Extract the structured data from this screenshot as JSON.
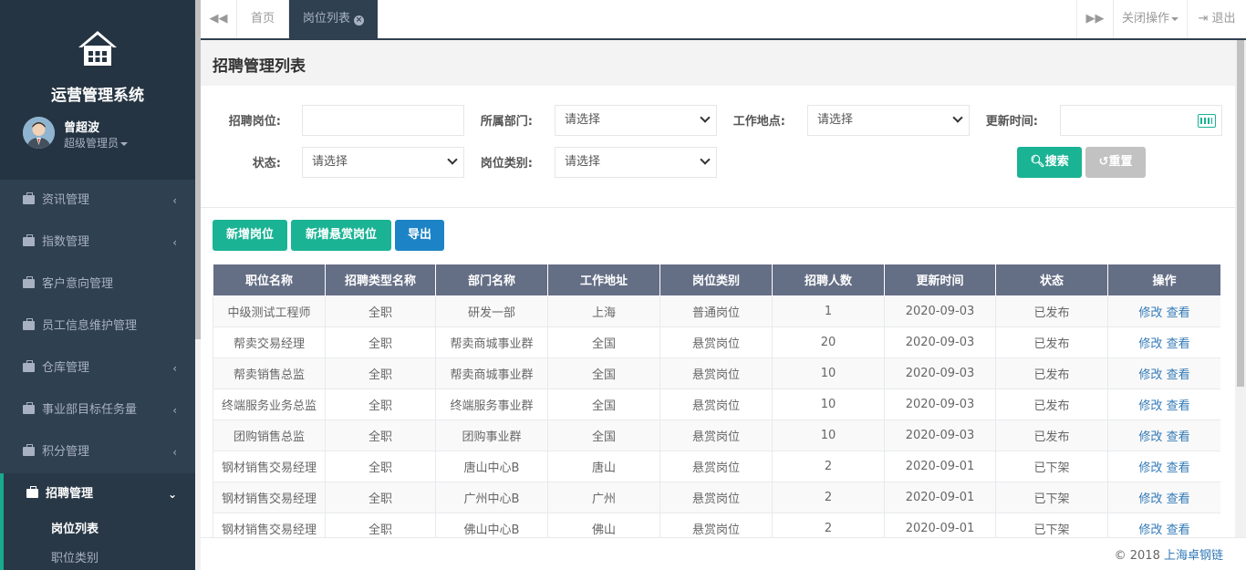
{
  "sidebar": {
    "title": "运营管理系统",
    "user_name": "曾超波",
    "user_role": "超级管理员",
    "menu": [
      {
        "label": "资讯管理",
        "has_arrow": true
      },
      {
        "label": "指数管理",
        "has_arrow": true
      },
      {
        "label": "客户意向管理",
        "has_arrow": false
      },
      {
        "label": "员工信息维护管理",
        "has_arrow": false
      },
      {
        "label": "仓库管理",
        "has_arrow": true
      },
      {
        "label": "事业部目标任务量",
        "has_arrow": true
      },
      {
        "label": "积分管理",
        "has_arrow": true
      }
    ],
    "active_menu": "招聘管理",
    "submenu": [
      "岗位列表",
      "职位类别"
    ]
  },
  "tabs": {
    "home": "首页",
    "active": "岗位列表",
    "close_ops": "关闭操作",
    "logout": "退出"
  },
  "page_title": "招聘管理列表",
  "form": {
    "post_label": "招聘岗位:",
    "post_value": "",
    "dept_label": "所属部门:",
    "dept_value": "请选择",
    "location_label": "工作地点:",
    "location_value": "请选择",
    "update_label": "更新时间:",
    "update_value": "",
    "status_label": "状态:",
    "status_value": "请选择",
    "category_label": "岗位类别:",
    "category_value": "请选择",
    "search_btn": "搜索",
    "reset_btn": "重置"
  },
  "actions": {
    "add_post": "新增岗位",
    "add_reward_post": "新增悬赏岗位",
    "export": "导出"
  },
  "table": {
    "headers": [
      "职位名称",
      "招聘类型名称",
      "部门名称",
      "工作地址",
      "岗位类别",
      "招聘人数",
      "更新时间",
      "状态",
      "操作"
    ],
    "rows": [
      [
        "中级测试工程师",
        "全职",
        "研发一部",
        "上海",
        "普通岗位",
        "1",
        "2020-09-03",
        "已发布"
      ],
      [
        "帮卖交易经理",
        "全职",
        "帮卖商城事业群",
        "全国",
        "悬赏岗位",
        "20",
        "2020-09-03",
        "已发布"
      ],
      [
        "帮卖销售总监",
        "全职",
        "帮卖商城事业群",
        "全国",
        "悬赏岗位",
        "10",
        "2020-09-03",
        "已发布"
      ],
      [
        "终端服务业务总监",
        "全职",
        "终端服务事业群",
        "全国",
        "悬赏岗位",
        "10",
        "2020-09-03",
        "已发布"
      ],
      [
        "团购销售总监",
        "全职",
        "团购事业群",
        "全国",
        "悬赏岗位",
        "10",
        "2020-09-03",
        "已发布"
      ],
      [
        "钢材销售交易经理",
        "全职",
        "唐山中心B",
        "唐山",
        "悬赏岗位",
        "2",
        "2020-09-01",
        "已下架"
      ],
      [
        "钢材销售交易经理",
        "全职",
        "广州中心B",
        "广州",
        "悬赏岗位",
        "2",
        "2020-09-01",
        "已下架"
      ],
      [
        "钢材销售交易经理",
        "全职",
        "佛山中心B",
        "佛山",
        "悬赏岗位",
        "2",
        "2020-09-01",
        "已下架"
      ]
    ],
    "edit_label": "修改",
    "view_label": "查看"
  },
  "footer": {
    "copyright": "© 2018",
    "company": "上海卓钢链"
  }
}
